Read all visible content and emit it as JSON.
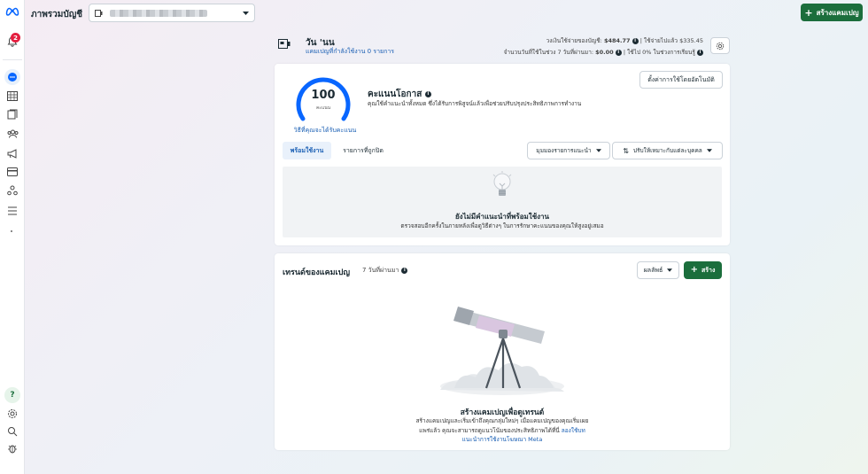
{
  "topbar": {
    "title": "ภาพรวมบัญชี",
    "create_campaign": "สร้างแคมเปญ"
  },
  "notifications": {
    "count": "2"
  },
  "header": {
    "name": "วัน 'นน",
    "subtitle": "แคมเปญที่กำลังใช้งาน 0 รายการ",
    "spend_line_prefix": "วงเงินใช้จ่ายของบัญชี:",
    "spend_value": "$484.77",
    "spend_line_suffix": "| ใช้จ่ายไปแล้ว $335.45",
    "days_prefix": "จำนวนวันที่ใช้ในช่วง 7 วันที่ผ่านมา:",
    "days_value": "$0.00",
    "days_suffix": "| ใช้ไป 0% ในช่วงการเรียนรู้"
  },
  "opportunity": {
    "score": "100",
    "score_caption": "คะแนน",
    "score_link": "วิธีที่คุณจะได้รับคะแนน",
    "title": "คะแนนโอกาส",
    "description": "คุณใช้คำแนะนำทั้งหมด ซึ่งได้รับการพิสูจน์แล้วเพื่อช่วยปรับปรุงประสิทธิภาพการทำงาน",
    "auto_button": "ตั้งค่าการใช้โดยอัตโนมัติ",
    "tabs": [
      "พร้อมใช้งาน",
      "รายการที่ถูกปิด"
    ],
    "view_dropdown": "มุมมองรายการแนะนำ",
    "sort_dropdown": "ปรับให้เหมาะกับแต่ละบุคคล",
    "empty_title": "ยังไม่มีคำแนะนำที่พร้อมใช้งาน",
    "empty_text": "ตรวจสอบอีกครั้งในภายหลังเพื่อดูวิธีต่างๆ ในการรักษาคะแนนของคุณให้สูงอยู่เสมอ"
  },
  "trends": {
    "title": "เทรนด์ของแคมเปญ",
    "period": "7 วันที่ผ่านมา",
    "results_dropdown": "ผลลัพธ์",
    "create_button": "สร้าง",
    "empty_title": "สร้างแคมเปญเพื่อดูเทรนด์",
    "empty_text_1": "สร้างแคมเปญและเริ่มเข้าถึงคุณกลุ่มใหม่ๆ เมื่อแคมเปญของคุณเริ่มเผย",
    "empty_text_2": "แพร่แล้ว คุณจะสามารถดูแนวโน้มของประสิทธิภาพได้ที่นี่",
    "empty_link_1": "ลองใช้บท",
    "empty_link_2": "แนะนำการใช้งานโฆษณา Meta"
  },
  "colors": {
    "accent": "#1b6e3c",
    "link": "#1a5fb4",
    "score_ring": "#0866ff",
    "badge": "#e41e3f"
  },
  "icons": [
    "meta-logo-icon",
    "bell-icon",
    "overview-icon",
    "table-icon",
    "pages-icon",
    "audience-icon",
    "megaphone-icon",
    "billing-icon",
    "people-icon",
    "menu-icon",
    "help-icon",
    "settings-icon",
    "search-icon",
    "bug-icon"
  ]
}
